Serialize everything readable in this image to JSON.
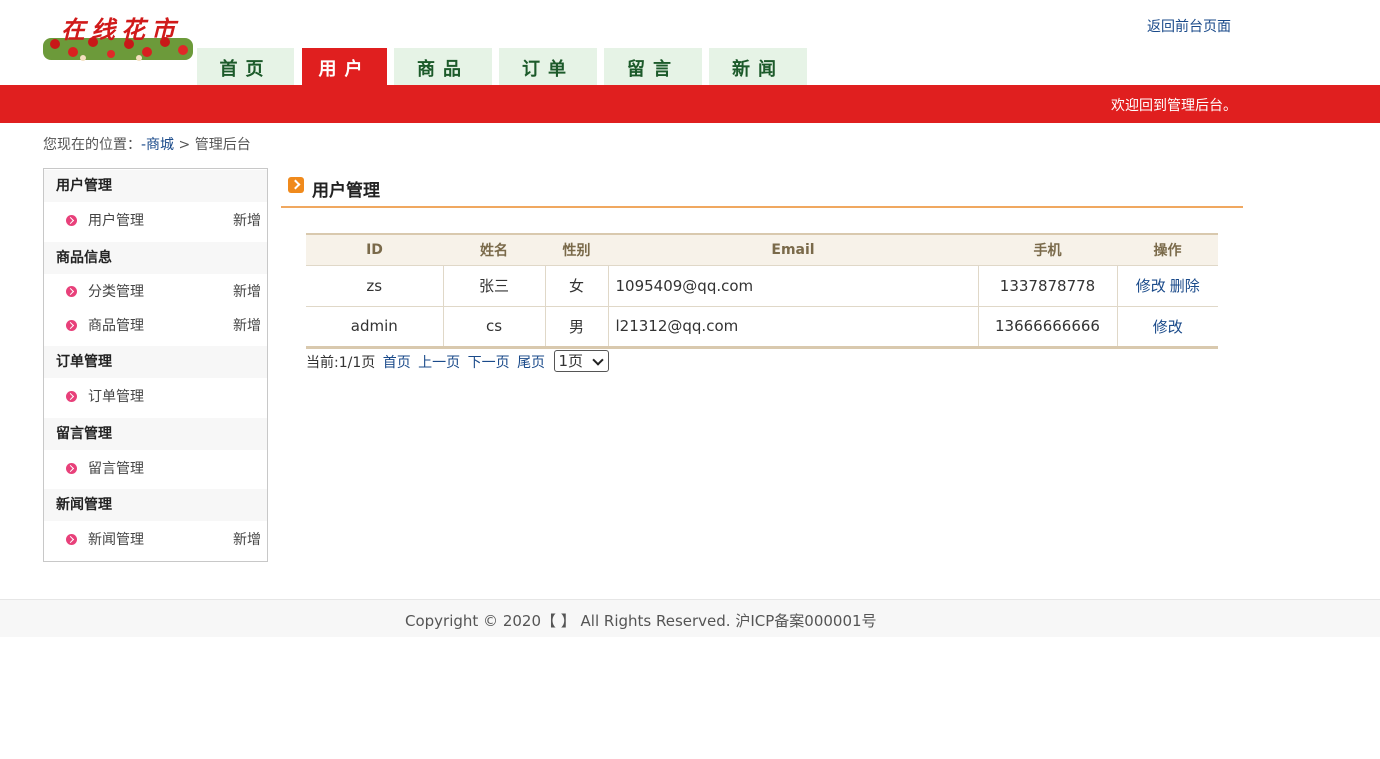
{
  "header": {
    "logo_text": "在线花市",
    "back_link": "返回前台页面"
  },
  "nav": {
    "tabs": [
      {
        "label": "首页",
        "active": false
      },
      {
        "label": "用户",
        "active": true
      },
      {
        "label": "商品",
        "active": false
      },
      {
        "label": "订单",
        "active": false
      },
      {
        "label": "留言",
        "active": false
      },
      {
        "label": "新闻",
        "active": false
      }
    ]
  },
  "banner": {
    "welcome": "欢迎回到管理后台。"
  },
  "breadcrumb": {
    "prefix": "您现在的位置：",
    "home_link": "-商城",
    "separator": " > ",
    "current": "管理后台"
  },
  "sidebar": {
    "groups": [
      {
        "title": "用户管理",
        "items": [
          {
            "label": "用户管理",
            "add": "新增"
          }
        ]
      },
      {
        "title": "商品信息",
        "items": [
          {
            "label": "分类管理",
            "add": "新增"
          },
          {
            "label": "商品管理",
            "add": "新增"
          }
        ]
      },
      {
        "title": "订单管理",
        "items": [
          {
            "label": "订单管理",
            "add": ""
          }
        ]
      },
      {
        "title": "留言管理",
        "items": [
          {
            "label": "留言管理",
            "add": ""
          }
        ]
      },
      {
        "title": "新闻管理",
        "items": [
          {
            "label": "新闻管理",
            "add": "新增"
          }
        ]
      }
    ]
  },
  "main": {
    "title": "用户管理",
    "table": {
      "headers": [
        "ID",
        "姓名",
        "性别",
        "Email",
        "手机",
        "操作"
      ],
      "rows": [
        {
          "id": "zs",
          "name": "张三",
          "gender": "女",
          "email": "1095409@qq.com",
          "phone": "1337878778",
          "actions": [
            "修改",
            "删除"
          ]
        },
        {
          "id": "admin",
          "name": "cs",
          "gender": "男",
          "email": "l21312@qq.com",
          "phone": "13666666666",
          "actions": [
            "修改"
          ]
        }
      ]
    },
    "pager": {
      "status": "当前:1/1页",
      "first": "首页",
      "prev": "上一页",
      "next": "下一页",
      "last": "尾页",
      "selected_page": "1页"
    }
  },
  "footer": {
    "text": "Copyright © 2020【 】 All Rights Reserved. 沪ICP备案000001号"
  },
  "colors": {
    "brand_red": "#e01f1f",
    "nav_tab_bg": "#e6f3e6",
    "link_blue": "#1a4a8a",
    "accent_orange": "#f0a860"
  }
}
